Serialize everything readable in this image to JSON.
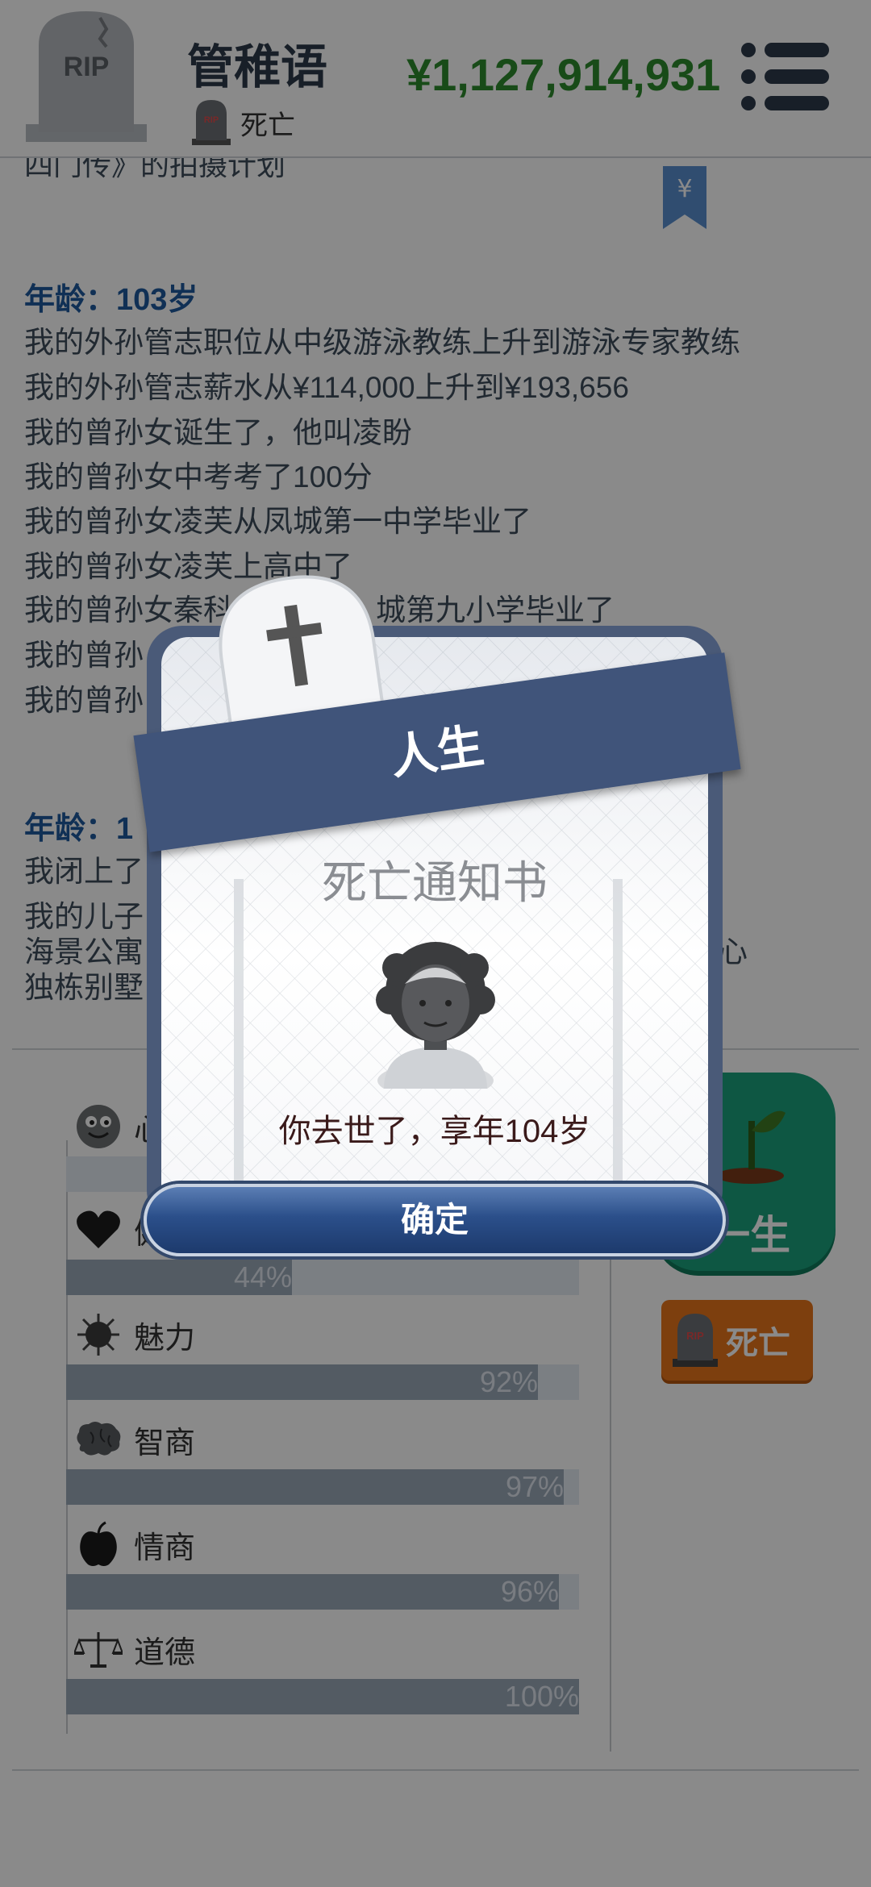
{
  "header": {
    "player_name": "管稚语",
    "status_text": "死亡",
    "money": "¥1,127,914,931",
    "avatar_text": "RIP"
  },
  "log": {
    "cut_line": "四门传》的拍摄计划",
    "entries": [
      {
        "age": "年龄：103岁",
        "lines": [
          "我的外孙管志职位从中级游泳教练上升到游泳专家教练",
          "我的外孙管志薪水从¥114,000上升到¥193,656",
          "我的曾孙女诞生了，他叫凌盼",
          "我的曾孙女中考考了100分",
          "我的曾孙女凌芙从凤城第一中学毕业了",
          "我的曾孙女凌芙上高中了",
          "我的曾孙女秦科",
          "城第九小学毕业了",
          "我的曾孙",
          "我的曾孙"
        ]
      },
      {
        "age": "年龄：1",
        "lines": [
          "我闭上了",
          "我的儿子",
          "海景公寓",
          "心",
          "独栋别墅"
        ]
      }
    ]
  },
  "stats": {
    "items": [
      {
        "name": "心",
        "percent": 0,
        "label": ""
      },
      {
        "name": "健",
        "percent": 44,
        "label": "44%"
      },
      {
        "name": "魅力",
        "percent": 92,
        "label": "92%"
      },
      {
        "name": "智商",
        "percent": 97,
        "label": "97%"
      },
      {
        "name": "情商",
        "percent": 96,
        "label": "96%"
      },
      {
        "name": "道德",
        "percent": 100,
        "label": "100%"
      }
    ]
  },
  "actions": {
    "next_life": "一生",
    "death": "死亡"
  },
  "modal": {
    "ribbon_title": "人生",
    "subtitle": "死亡通知书",
    "message": "你去世了，享年104岁",
    "confirm": "确定"
  },
  "colors": {
    "accent_blue": "#1f5a9e",
    "money_green": "#2e8b2e",
    "next_life_green": "#1aa17c",
    "death_orange": "#e8751a",
    "ribbon_navy": "#40547a"
  }
}
